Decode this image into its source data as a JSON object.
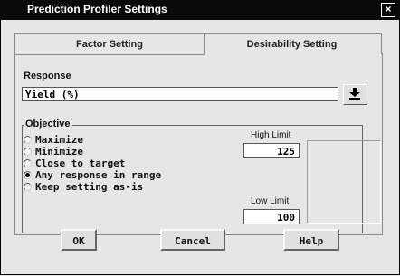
{
  "window": {
    "title": "Prediction Profiler Settings",
    "close": "×"
  },
  "tabs": [
    {
      "label": "Factor Setting"
    },
    {
      "label": "Desirability Setting"
    }
  ],
  "response": {
    "label": "Response",
    "value": "Yield (%)"
  },
  "objective": {
    "label": "Objective",
    "options": [
      {
        "label": "Maximize",
        "checked": false
      },
      {
        "label": "Minimize",
        "checked": false
      },
      {
        "label": "Close to target",
        "checked": false
      },
      {
        "label": "Any response in range",
        "checked": true
      },
      {
        "label": "Keep setting as-is",
        "checked": false
      }
    ]
  },
  "limits": {
    "high_label": "High Limit",
    "high_value": "125",
    "low_label": "Low Limit",
    "low_value": "100"
  },
  "buttons": {
    "ok": "OK",
    "cancel": "Cancel",
    "help": "Help"
  }
}
